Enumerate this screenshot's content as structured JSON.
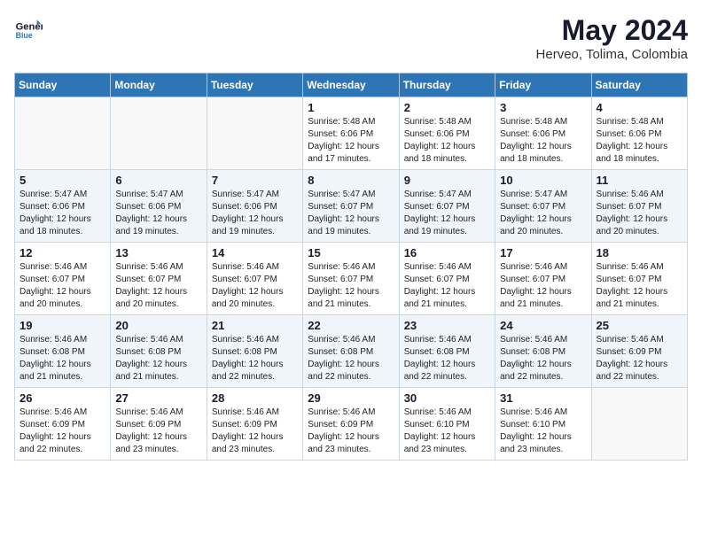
{
  "header": {
    "logo_line1": "General",
    "logo_line2": "Blue",
    "month_year": "May 2024",
    "location": "Herveo, Tolima, Colombia"
  },
  "days_of_week": [
    "Sunday",
    "Monday",
    "Tuesday",
    "Wednesday",
    "Thursday",
    "Friday",
    "Saturday"
  ],
  "weeks": [
    [
      {
        "day": "",
        "info": ""
      },
      {
        "day": "",
        "info": ""
      },
      {
        "day": "",
        "info": ""
      },
      {
        "day": "1",
        "info": "Sunrise: 5:48 AM\nSunset: 6:06 PM\nDaylight: 12 hours\nand 17 minutes."
      },
      {
        "day": "2",
        "info": "Sunrise: 5:48 AM\nSunset: 6:06 PM\nDaylight: 12 hours\nand 18 minutes."
      },
      {
        "day": "3",
        "info": "Sunrise: 5:48 AM\nSunset: 6:06 PM\nDaylight: 12 hours\nand 18 minutes."
      },
      {
        "day": "4",
        "info": "Sunrise: 5:48 AM\nSunset: 6:06 PM\nDaylight: 12 hours\nand 18 minutes."
      }
    ],
    [
      {
        "day": "5",
        "info": "Sunrise: 5:47 AM\nSunset: 6:06 PM\nDaylight: 12 hours\nand 18 minutes."
      },
      {
        "day": "6",
        "info": "Sunrise: 5:47 AM\nSunset: 6:06 PM\nDaylight: 12 hours\nand 19 minutes."
      },
      {
        "day": "7",
        "info": "Sunrise: 5:47 AM\nSunset: 6:06 PM\nDaylight: 12 hours\nand 19 minutes."
      },
      {
        "day": "8",
        "info": "Sunrise: 5:47 AM\nSunset: 6:07 PM\nDaylight: 12 hours\nand 19 minutes."
      },
      {
        "day": "9",
        "info": "Sunrise: 5:47 AM\nSunset: 6:07 PM\nDaylight: 12 hours\nand 19 minutes."
      },
      {
        "day": "10",
        "info": "Sunrise: 5:47 AM\nSunset: 6:07 PM\nDaylight: 12 hours\nand 20 minutes."
      },
      {
        "day": "11",
        "info": "Sunrise: 5:46 AM\nSunset: 6:07 PM\nDaylight: 12 hours\nand 20 minutes."
      }
    ],
    [
      {
        "day": "12",
        "info": "Sunrise: 5:46 AM\nSunset: 6:07 PM\nDaylight: 12 hours\nand 20 minutes."
      },
      {
        "day": "13",
        "info": "Sunrise: 5:46 AM\nSunset: 6:07 PM\nDaylight: 12 hours\nand 20 minutes."
      },
      {
        "day": "14",
        "info": "Sunrise: 5:46 AM\nSunset: 6:07 PM\nDaylight: 12 hours\nand 20 minutes."
      },
      {
        "day": "15",
        "info": "Sunrise: 5:46 AM\nSunset: 6:07 PM\nDaylight: 12 hours\nand 21 minutes."
      },
      {
        "day": "16",
        "info": "Sunrise: 5:46 AM\nSunset: 6:07 PM\nDaylight: 12 hours\nand 21 minutes."
      },
      {
        "day": "17",
        "info": "Sunrise: 5:46 AM\nSunset: 6:07 PM\nDaylight: 12 hours\nand 21 minutes."
      },
      {
        "day": "18",
        "info": "Sunrise: 5:46 AM\nSunset: 6:07 PM\nDaylight: 12 hours\nand 21 minutes."
      }
    ],
    [
      {
        "day": "19",
        "info": "Sunrise: 5:46 AM\nSunset: 6:08 PM\nDaylight: 12 hours\nand 21 minutes."
      },
      {
        "day": "20",
        "info": "Sunrise: 5:46 AM\nSunset: 6:08 PM\nDaylight: 12 hours\nand 21 minutes."
      },
      {
        "day": "21",
        "info": "Sunrise: 5:46 AM\nSunset: 6:08 PM\nDaylight: 12 hours\nand 22 minutes."
      },
      {
        "day": "22",
        "info": "Sunrise: 5:46 AM\nSunset: 6:08 PM\nDaylight: 12 hours\nand 22 minutes."
      },
      {
        "day": "23",
        "info": "Sunrise: 5:46 AM\nSunset: 6:08 PM\nDaylight: 12 hours\nand 22 minutes."
      },
      {
        "day": "24",
        "info": "Sunrise: 5:46 AM\nSunset: 6:08 PM\nDaylight: 12 hours\nand 22 minutes."
      },
      {
        "day": "25",
        "info": "Sunrise: 5:46 AM\nSunset: 6:09 PM\nDaylight: 12 hours\nand 22 minutes."
      }
    ],
    [
      {
        "day": "26",
        "info": "Sunrise: 5:46 AM\nSunset: 6:09 PM\nDaylight: 12 hours\nand 22 minutes."
      },
      {
        "day": "27",
        "info": "Sunrise: 5:46 AM\nSunset: 6:09 PM\nDaylight: 12 hours\nand 23 minutes."
      },
      {
        "day": "28",
        "info": "Sunrise: 5:46 AM\nSunset: 6:09 PM\nDaylight: 12 hours\nand 23 minutes."
      },
      {
        "day": "29",
        "info": "Sunrise: 5:46 AM\nSunset: 6:09 PM\nDaylight: 12 hours\nand 23 minutes."
      },
      {
        "day": "30",
        "info": "Sunrise: 5:46 AM\nSunset: 6:10 PM\nDaylight: 12 hours\nand 23 minutes."
      },
      {
        "day": "31",
        "info": "Sunrise: 5:46 AM\nSunset: 6:10 PM\nDaylight: 12 hours\nand 23 minutes."
      },
      {
        "day": "",
        "info": ""
      }
    ]
  ]
}
